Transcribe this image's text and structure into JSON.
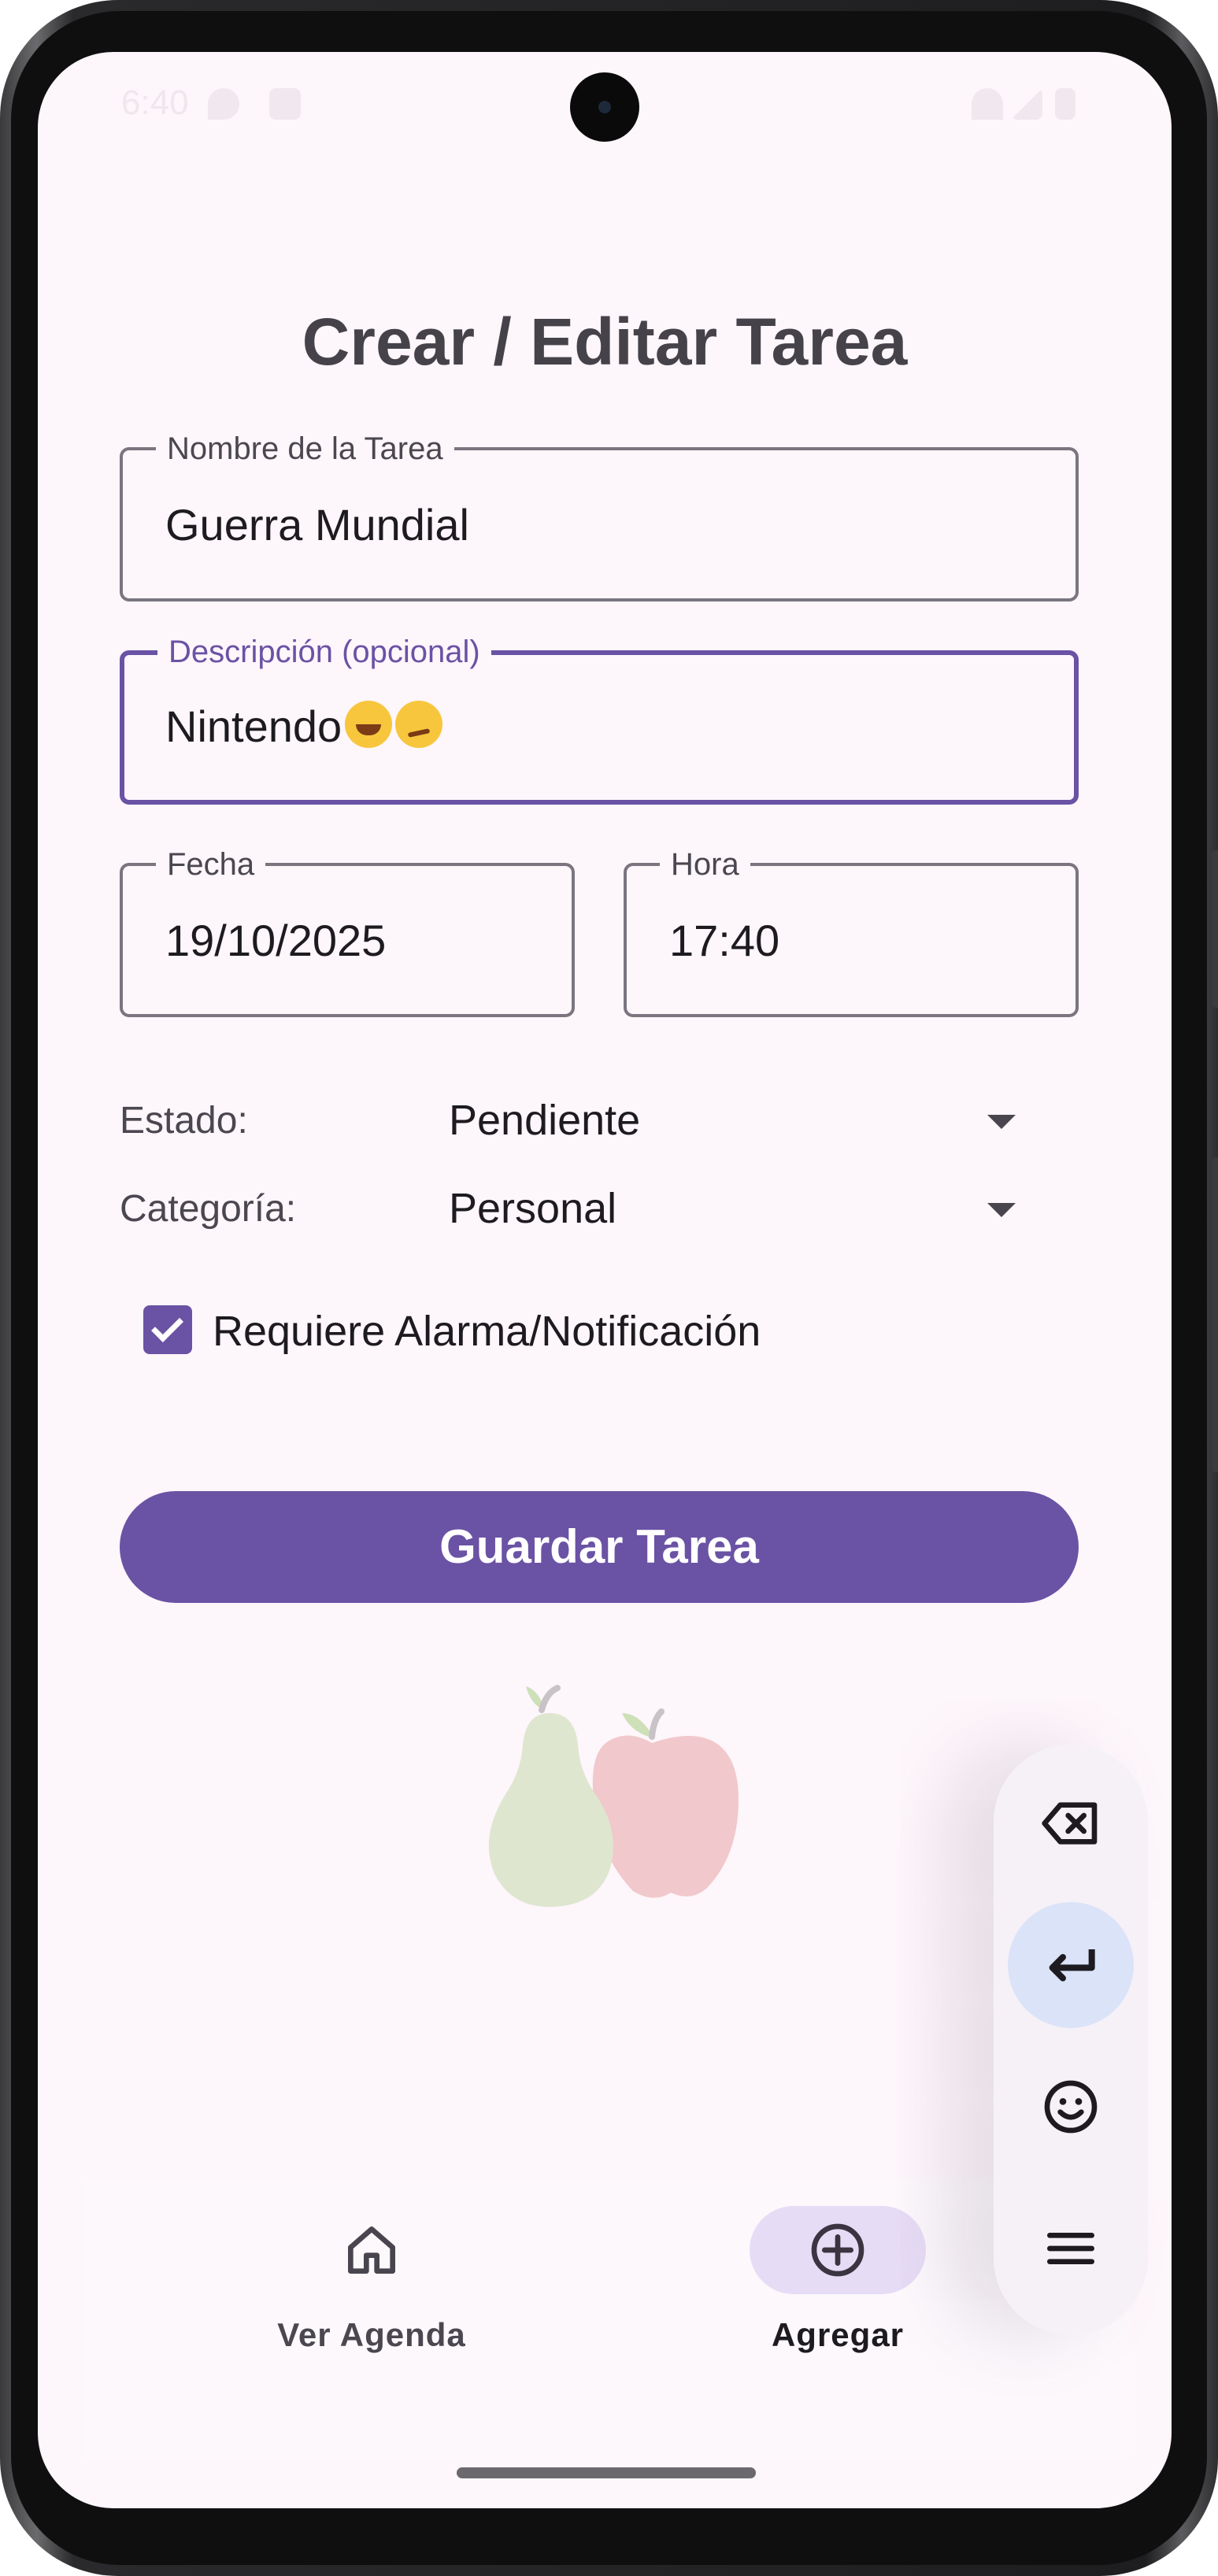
{
  "status_bar": {
    "time": "6:40"
  },
  "page": {
    "title": "Crear / Editar Tarea"
  },
  "form": {
    "task_name": {
      "label": "Nombre de la Tarea",
      "value": "Guerra Mundial"
    },
    "description": {
      "label": "Descripción (opcional)",
      "value": "Nintendo",
      "emojis": [
        "grinning-squinting-face",
        "woozy-face"
      ]
    },
    "date": {
      "label": "Fecha",
      "value": "19/10/2025"
    },
    "time": {
      "label": "Hora",
      "value": "17:40"
    },
    "status": {
      "label": "Estado:",
      "value": "Pendiente"
    },
    "category": {
      "label": "Categoría:",
      "value": "Personal"
    },
    "alarm": {
      "label": "Requiere Alarma/Notificación",
      "checked": true
    },
    "save_label": "Guardar Tarea"
  },
  "bottom_nav": [
    {
      "label": "Ver Agenda",
      "icon": "home-icon",
      "active": false
    },
    {
      "label": "Agregar",
      "icon": "add-circle-icon",
      "active": true
    }
  ],
  "keyboard_panel": {
    "keys": [
      "backspace-icon",
      "enter-icon",
      "emoji-icon",
      "menu-icon"
    ]
  },
  "colors": {
    "primary": "#6a52a4",
    "background": "#fdf6fb",
    "nav_active": "#e7dcf6",
    "enter_key": "#dbe3f8"
  }
}
